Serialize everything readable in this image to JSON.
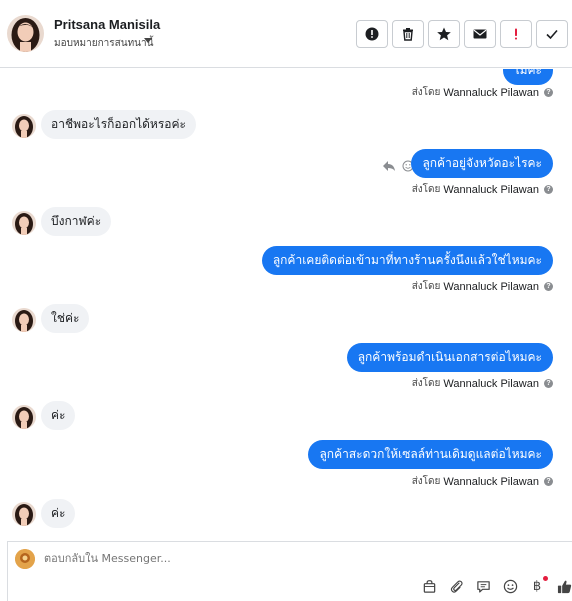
{
  "header": {
    "name": "Pritsana Manisila",
    "assign_label": "มอบหมายการสนทนานี้"
  },
  "actions": [
    {
      "name": "report-icon"
    },
    {
      "name": "trash-icon"
    },
    {
      "name": "star-icon"
    },
    {
      "name": "envelope-icon"
    },
    {
      "name": "exclamation-icon"
    },
    {
      "name": "check-icon"
    }
  ],
  "sent_by": {
    "prefix": "ส่งโดย",
    "agent": "Wannaluck Pilawan"
  },
  "messages": [
    {
      "dir": "out",
      "text": "ไม่คะ"
    },
    {
      "dir": "in",
      "text": "อาชีพอะไรก็ออกได้หรอค่ะ"
    },
    {
      "dir": "out",
      "text": "ลูกค้าอยู่จังหวัดอะไรคะ"
    },
    {
      "dir": "in",
      "text": "บึงกาฬค่ะ"
    },
    {
      "dir": "out",
      "text": "ลูกค้าเคยติดต่อเข้ามาที่ทางร้านครั้งนึงแล้วใช่ไหมคะ"
    },
    {
      "dir": "in",
      "text": "ใช่ค่ะ"
    },
    {
      "dir": "out",
      "text": "ลูกค้าพร้อมดำเนินเอกสารต่อไหมคะ"
    },
    {
      "dir": "in",
      "text": "ค่ะ"
    },
    {
      "dir": "out",
      "text": "ลูกค้าสะดวกให้เซลล์ท่านเดิมดูแลต่อไหมคะ"
    },
    {
      "dir": "in",
      "text": "ค่ะ"
    }
  ],
  "composer": {
    "placeholder": "ตอบกลับใน Messenger..."
  },
  "colors": {
    "accent": "#1877f2",
    "incoming_bg": "#f0f2f5",
    "alert_red": "#e41e3f"
  }
}
